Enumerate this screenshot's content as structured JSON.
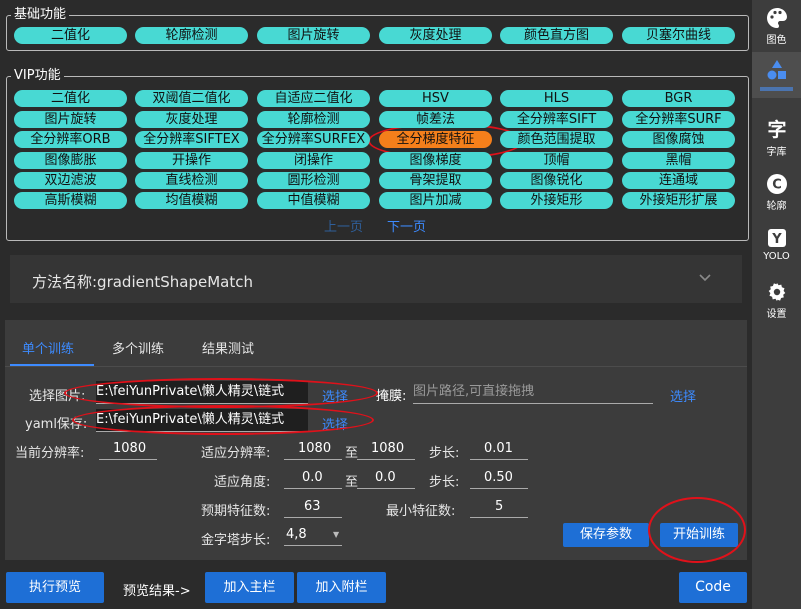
{
  "basic": {
    "title": "基础功能",
    "items": [
      "二值化",
      "轮廓检测",
      "图片旋转",
      "灰度处理",
      "颜色直方图",
      "贝塞尔曲线"
    ]
  },
  "vip": {
    "title": "VIP功能",
    "rows": [
      [
        "二值化",
        "双阈值二值化",
        "自适应二值化",
        "HSV",
        "HLS",
        "BGR"
      ],
      [
        "图片旋转",
        "灰度处理",
        "轮廓检测",
        "帧差法",
        "全分辨率SIFT",
        "全分辨率SURF"
      ],
      [
        "全分辨率ORB",
        "全分辨率SIFTEX",
        "全分辨率SURFEX",
        "全分梯度特征",
        "颜色范围提取",
        "图像腐蚀"
      ],
      [
        "图像膨胀",
        "开操作",
        "闭操作",
        "图像梯度",
        "顶帽",
        "黑帽"
      ],
      [
        "双边滤波",
        "直线检测",
        "圆形检测",
        "骨架提取",
        "图像锐化",
        "连通域"
      ],
      [
        "高斯模糊",
        "均值模糊",
        "中值模糊",
        "图片加减",
        "外接矩形",
        "外接矩形扩展"
      ]
    ],
    "active": "全分梯度特征",
    "prev_page": "上一页",
    "next_page": "下一页"
  },
  "method": {
    "label": "方法名称:gradientShapeMatch"
  },
  "tabs": [
    "单个训练",
    "多个训练",
    "结果测试"
  ],
  "form": {
    "select_image_label": "选择图片:",
    "select_image_value": "E:\\feiYunPrivate\\懒人精灵\\链式",
    "select_link": "选择",
    "mask_label": "掩膜:",
    "mask_placeholder": "图片路径,可直接拖拽",
    "mask_select": "选择",
    "yaml_label": "yaml保存:",
    "yaml_value": "E:\\feiYunPrivate\\懒人精灵\\链式",
    "yaml_select": "选择",
    "current_res_label": "当前分辨率:",
    "current_res": "1080",
    "adapt_res_label": "适应分辨率:",
    "adapt_res_from": "1080",
    "to1": "至",
    "adapt_res_to": "1080",
    "step_label1": "步长:",
    "step1": "0.01",
    "adapt_angle_label": "适应角度:",
    "angle_from": "0.0",
    "to2": "至",
    "angle_to": "0.0",
    "step_label2": "步长:",
    "step2": "0.50",
    "expected_label": "预期特征数:",
    "expected": "63",
    "min_label": "最小特征数:",
    "min": "5",
    "pyramid_label": "金字塔步长:",
    "pyramid": "4,8",
    "save_params": "保存参数",
    "start_train": "开始训练"
  },
  "bottom": {
    "run_preview": "执行预览",
    "preview_result": "预览结果->",
    "add_main": "加入主栏",
    "add_sub": "加入附栏",
    "code": "Code"
  },
  "sidebar": [
    {
      "label": "图色",
      "icon": "palette-icon"
    },
    {
      "label": "",
      "icon": "shapes-icon"
    },
    {
      "label": "字库",
      "icon": "font-icon"
    },
    {
      "label": "轮廓",
      "icon": "contour-icon"
    },
    {
      "label": "YOLO",
      "icon": "yolo-icon"
    },
    {
      "label": "设置",
      "icon": "gear-icon"
    }
  ],
  "colors": {
    "pill": "#48d9d3",
    "active": "#f47f1b",
    "accent": "#1e6fd6",
    "ring": "#e0111a"
  }
}
